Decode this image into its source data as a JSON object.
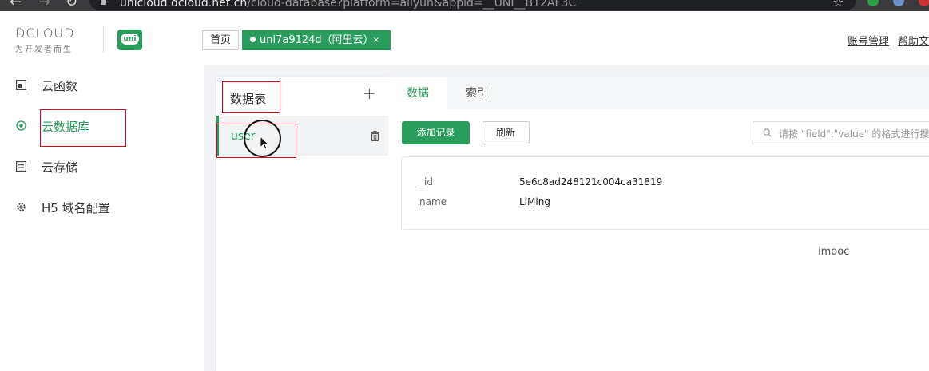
{
  "browser": {
    "url_host": "unicloud.dcloud.net.cn",
    "url_path": "/cloud-database?platform=aliyun&appid=__UNI__B12AF3C"
  },
  "header": {
    "logo_text": "DCLOUD",
    "logo_tagline": "为开发者而生",
    "uni_logo_text": "uni",
    "tab_home": "首页",
    "tab_active": "uni7a9124d（阿里云）",
    "tab_close": "×",
    "link_account": "账号管理",
    "link_help": "帮助文"
  },
  "sidebar": {
    "items": [
      {
        "label": "云函数",
        "icon": "function-icon"
      },
      {
        "label": "云数据库",
        "icon": "database-icon",
        "active": true
      },
      {
        "label": "云存储",
        "icon": "storage-icon"
      },
      {
        "label": "H5 域名配置",
        "icon": "gear-icon"
      }
    ]
  },
  "tables_panel": {
    "title": "数据表",
    "add_symbol": "+",
    "tables": [
      {
        "label": "user"
      }
    ]
  },
  "content": {
    "tabs": [
      {
        "label": "数据"
      },
      {
        "label": "索引"
      }
    ],
    "add_button": "添加记录",
    "refresh_button": "刷新",
    "search_placeholder": "请按 \"field\":\"value\" 的格式进行搜",
    "record": {
      "fields": [
        {
          "key": "_id",
          "value": "5e6c8ad248121c004ca31819"
        },
        {
          "key": "name",
          "value": "LiMing"
        }
      ]
    }
  },
  "watermark": "imooc",
  "colors": {
    "accent": "#2a9d5c",
    "annotation": "#e0001b"
  }
}
